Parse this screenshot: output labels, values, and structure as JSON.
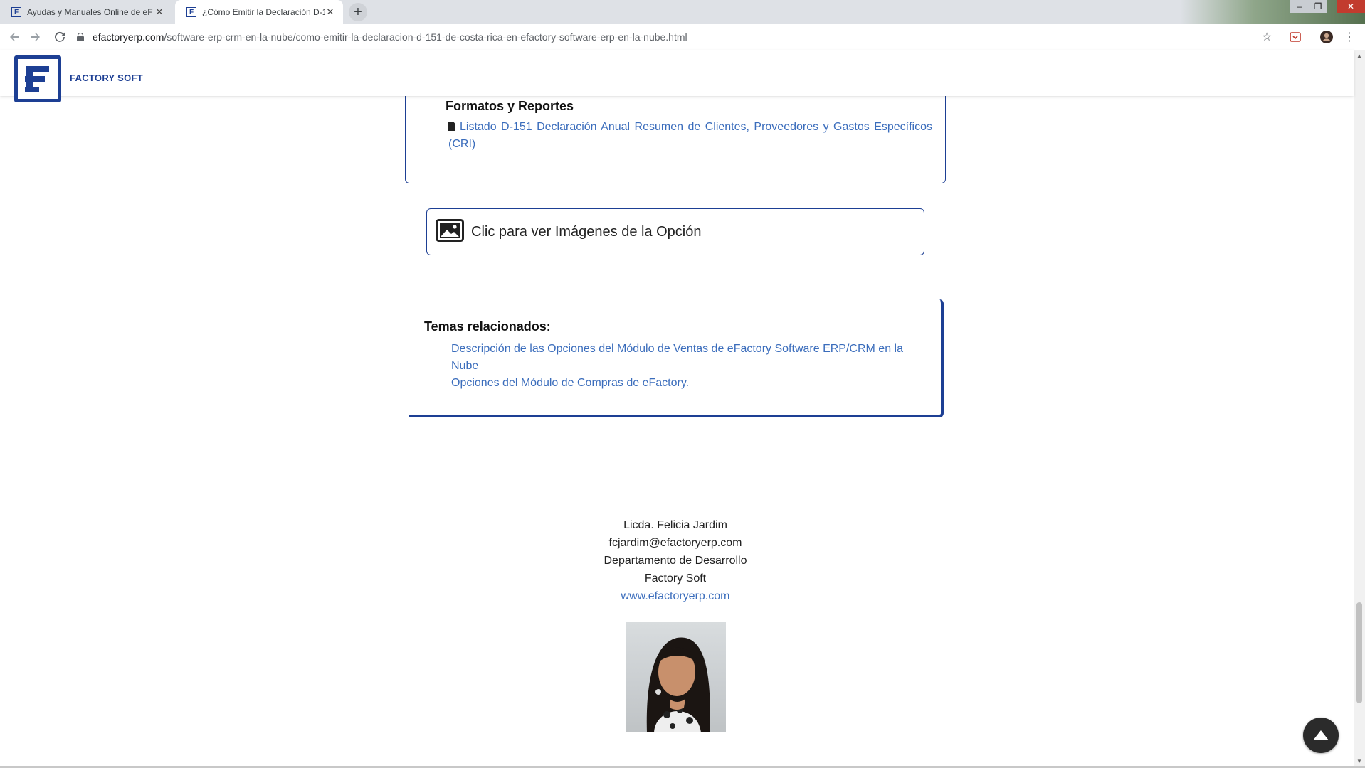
{
  "browser": {
    "tabs": [
      {
        "title": "Ayudas y Manuales Online de eF",
        "active": false
      },
      {
        "title": "¿Cómo Emitir la Declaración D-1",
        "active": true
      }
    ],
    "url_host": "efactoryerp.com",
    "url_path": "/software-erp-crm-en-la-nube/como-emitir-la-declaracion-d-151-de-costa-rica-en-efactory-software-erp-en-la-nube.html",
    "icons": [
      "back-icon",
      "forward-icon",
      "reload-icon",
      "lock-icon",
      "star-icon",
      "extension-icon",
      "profile-icon",
      "menu-icon",
      "new-tab-icon",
      "close-icon"
    ]
  },
  "header": {
    "brand": "FACTORY SOFT",
    "brand_color": "#1d3f94"
  },
  "formats": {
    "title": "Formatos y Reportes",
    "link": "Listado D-151 Declaración Anual Resumen de Clientes, Proveedores y Gastos Específicos (CRI)"
  },
  "images_button": {
    "label": "Clic para ver Imágenes de la Opción"
  },
  "related": {
    "heading": "Temas relacionados:",
    "links": [
      "Descripción de las Opciones del Módulo de Ventas de eFactory Software ERP/CRM en la Nube",
      "Opciones del Módulo de Compras de eFactory."
    ]
  },
  "signature": {
    "name": "Licda. Felicia Jardim",
    "email": "fcjardim@efactoryerp.com",
    "department": "Departamento de Desarrollo",
    "company": "Factory Soft",
    "website": "www.efactoryerp.com"
  },
  "colors": {
    "accent": "#1d3f94",
    "link": "#3b6dbc"
  }
}
